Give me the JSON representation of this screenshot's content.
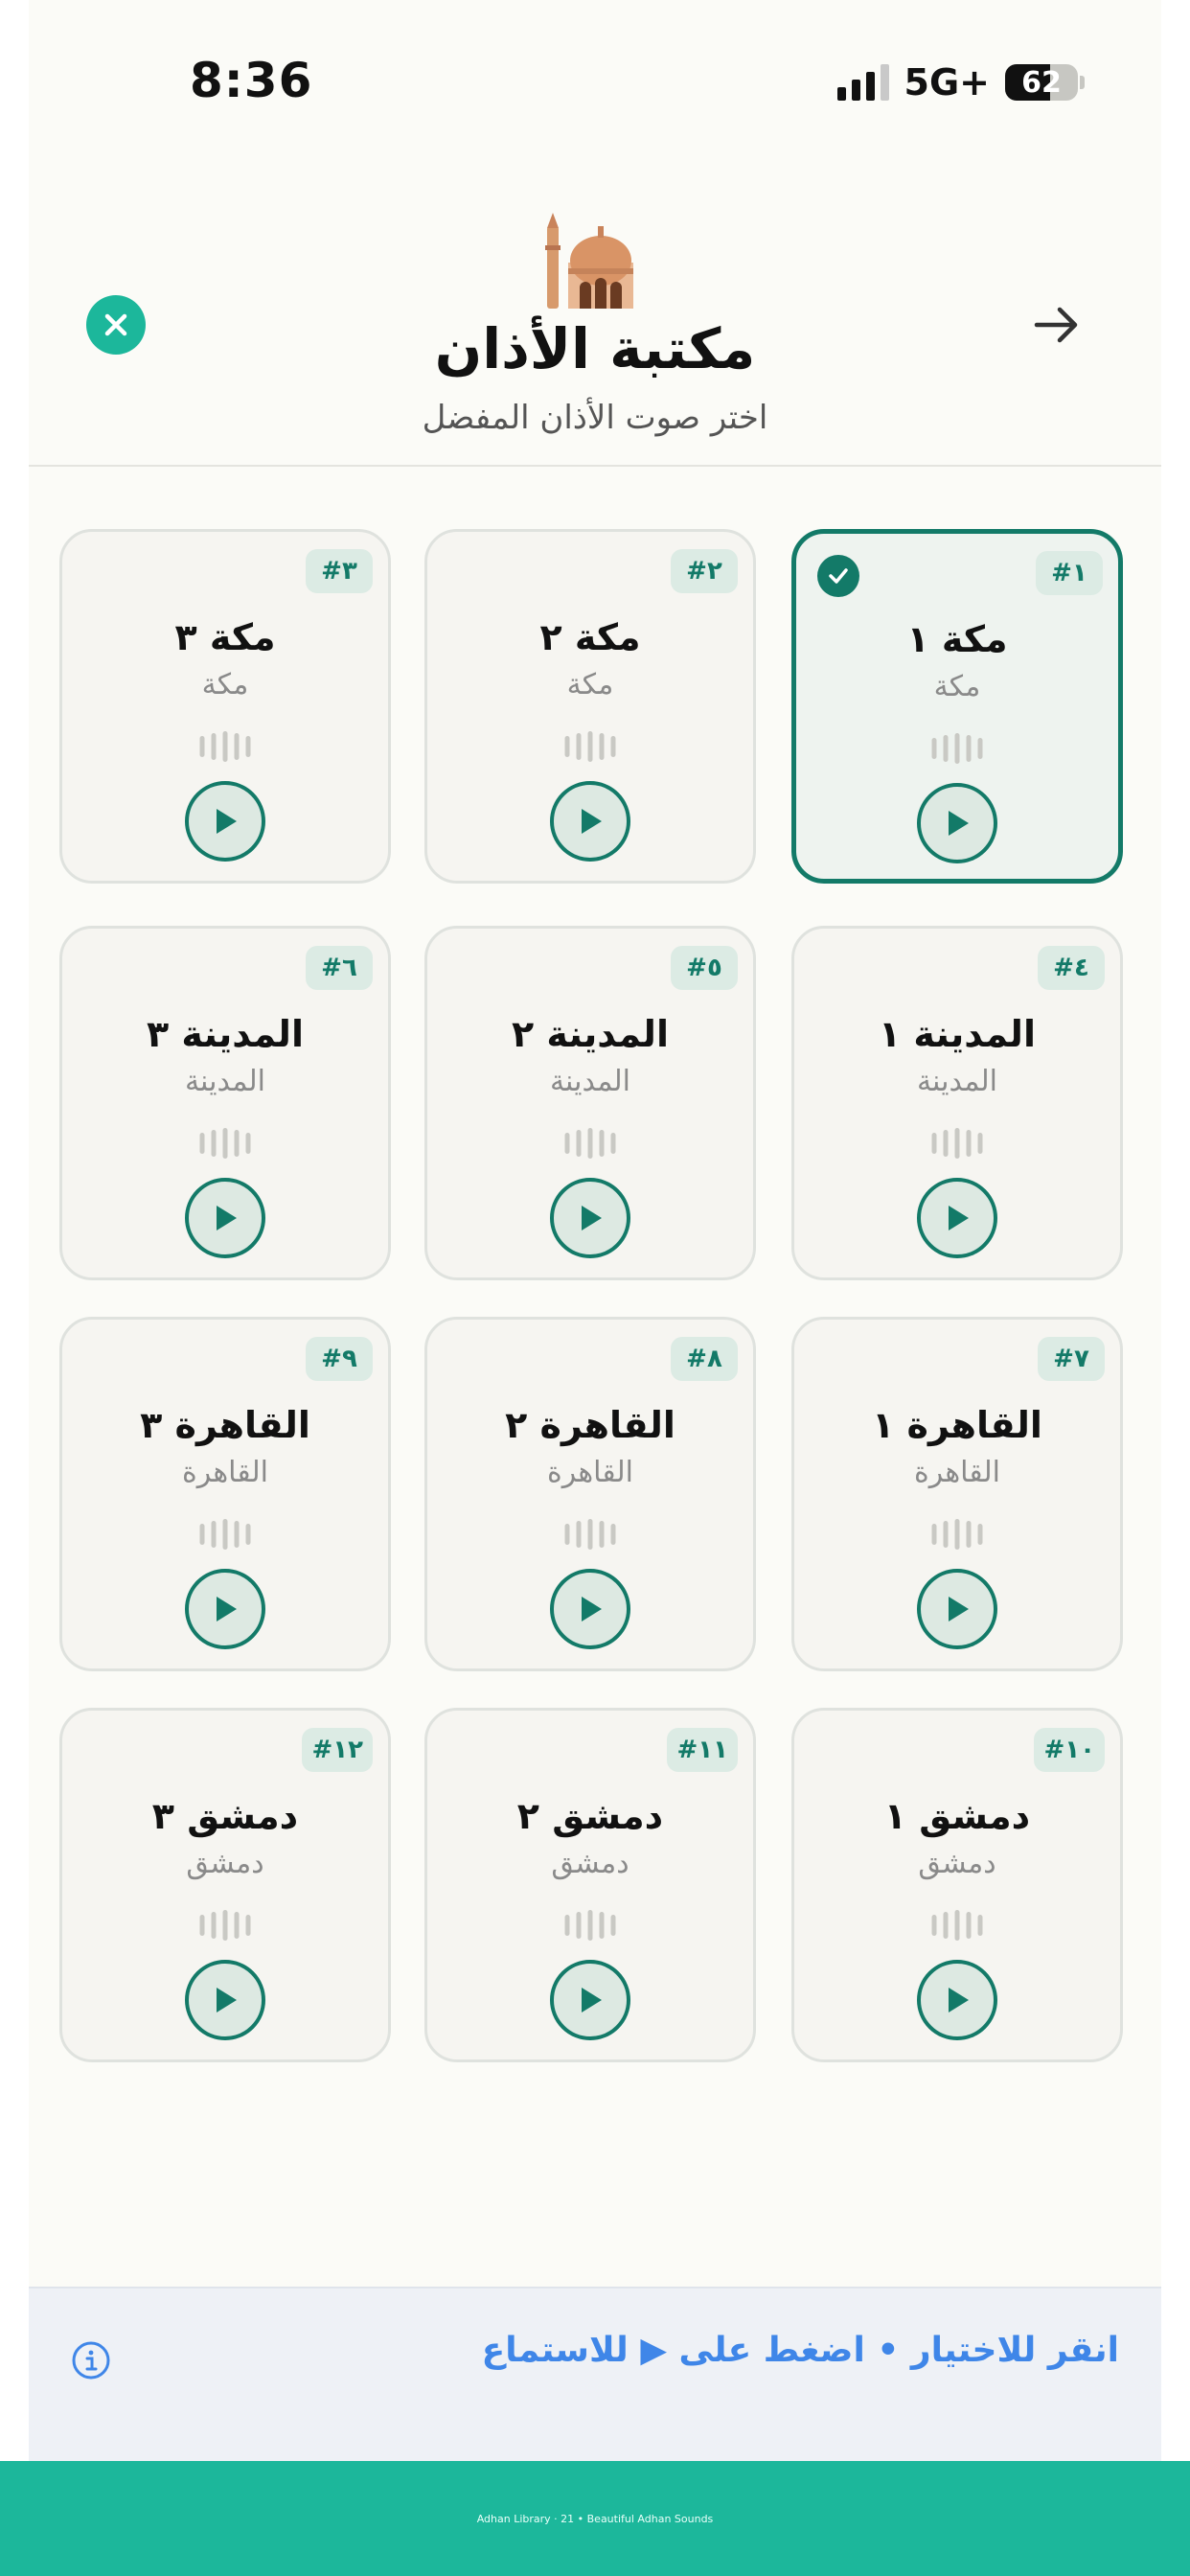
{
  "status_bar": {
    "time": "8:36",
    "network": "5G+",
    "battery": "62"
  },
  "header": {
    "title": "مكتبة الأذان",
    "subtitle": "اختر صوت الأذان المفضل",
    "close_icon": "close-icon",
    "forward_icon": "arrow-right-icon",
    "logo_icon": "mosque-icon"
  },
  "cards": [
    {
      "badge": "#١",
      "title": "مكة ١",
      "subtitle": "مكة",
      "selected": true
    },
    {
      "badge": "#٢",
      "title": "مكة ٢",
      "subtitle": "مكة",
      "selected": false
    },
    {
      "badge": "#٣",
      "title": "مكة ٣",
      "subtitle": "مكة",
      "selected": false
    },
    {
      "badge": "#٤",
      "title": "المدينة ١",
      "subtitle": "المدينة",
      "selected": false
    },
    {
      "badge": "#٥",
      "title": "المدينة ٢",
      "subtitle": "المدينة",
      "selected": false
    },
    {
      "badge": "#٦",
      "title": "المدينة ٣",
      "subtitle": "المدينة",
      "selected": false
    },
    {
      "badge": "#٧",
      "title": "القاهرة ١",
      "subtitle": "القاهرة",
      "selected": false
    },
    {
      "badge": "#٨",
      "title": "القاهرة ٢",
      "subtitle": "القاهرة",
      "selected": false
    },
    {
      "badge": "#٩",
      "title": "القاهرة ٣",
      "subtitle": "القاهرة",
      "selected": false
    },
    {
      "badge": "#١٠",
      "title": "دمشق ١",
      "subtitle": "دمشق",
      "selected": false
    },
    {
      "badge": "#١١",
      "title": "دمشق ٢",
      "subtitle": "دمشق",
      "selected": false
    },
    {
      "badge": "#١٢",
      "title": "دمشق ٣",
      "subtitle": "دمشق",
      "selected": false
    }
  ],
  "hint": {
    "text": "انقر للاختيار • اضغط على ▶ للاستماع",
    "icon": "info-icon"
  },
  "footer": {
    "text": "Adhan Library · 21 • Beautiful Adhan Sounds"
  },
  "colors": {
    "accent": "#1cb79b",
    "primary": "#137a68",
    "hint": "#3f86e8"
  }
}
